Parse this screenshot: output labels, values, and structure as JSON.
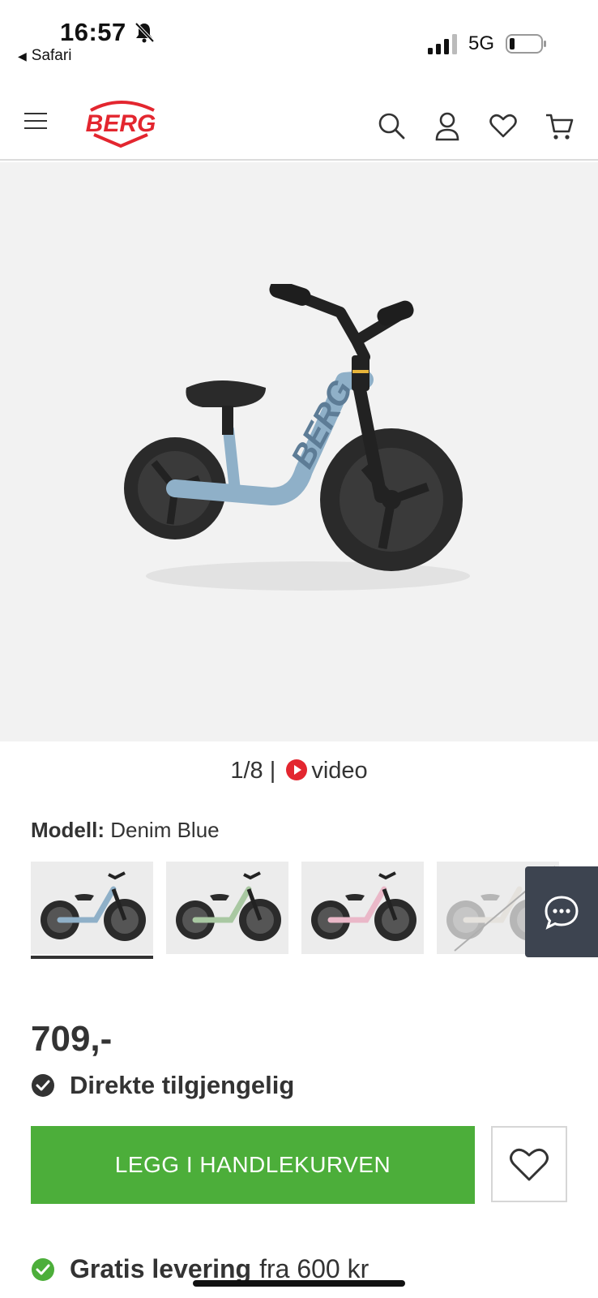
{
  "status_bar": {
    "time": "16:57",
    "back_app": "Safari",
    "network": "5G",
    "icons": [
      "bell-off-icon",
      "signal-icon",
      "battery-icon"
    ]
  },
  "header": {
    "logo_text": "BERG",
    "brand_color": "#e3262f",
    "icons": [
      "menu-icon",
      "search-icon",
      "account-icon",
      "heart-icon",
      "cart-icon"
    ]
  },
  "gallery": {
    "counter": "1/8 |",
    "video_label": "video",
    "bike_brand_text": "BERG"
  },
  "model": {
    "label": "Modell:",
    "value": "Denim Blue",
    "swatches": [
      {
        "name": "Denim Blue",
        "color": "#8fb0c8",
        "active": true
      },
      {
        "name": "Green",
        "color": "#a9c8a2",
        "active": false
      },
      {
        "name": "Pink",
        "color": "#eab8c8",
        "active": false
      },
      {
        "name": "Beige",
        "color": "#ddd6cc",
        "active": false,
        "unavailable": true
      }
    ]
  },
  "chat": {
    "icon": "chat-icon",
    "color": "#3d4450"
  },
  "product": {
    "price": "709,-",
    "availability": "Direkte tilgjengelig",
    "add_to_cart": "LEGG I HANDLEKURVEN",
    "accent": "#4cae3a"
  },
  "delivery": {
    "bold": "Gratis levering",
    "rest": "fra 600 kr"
  }
}
